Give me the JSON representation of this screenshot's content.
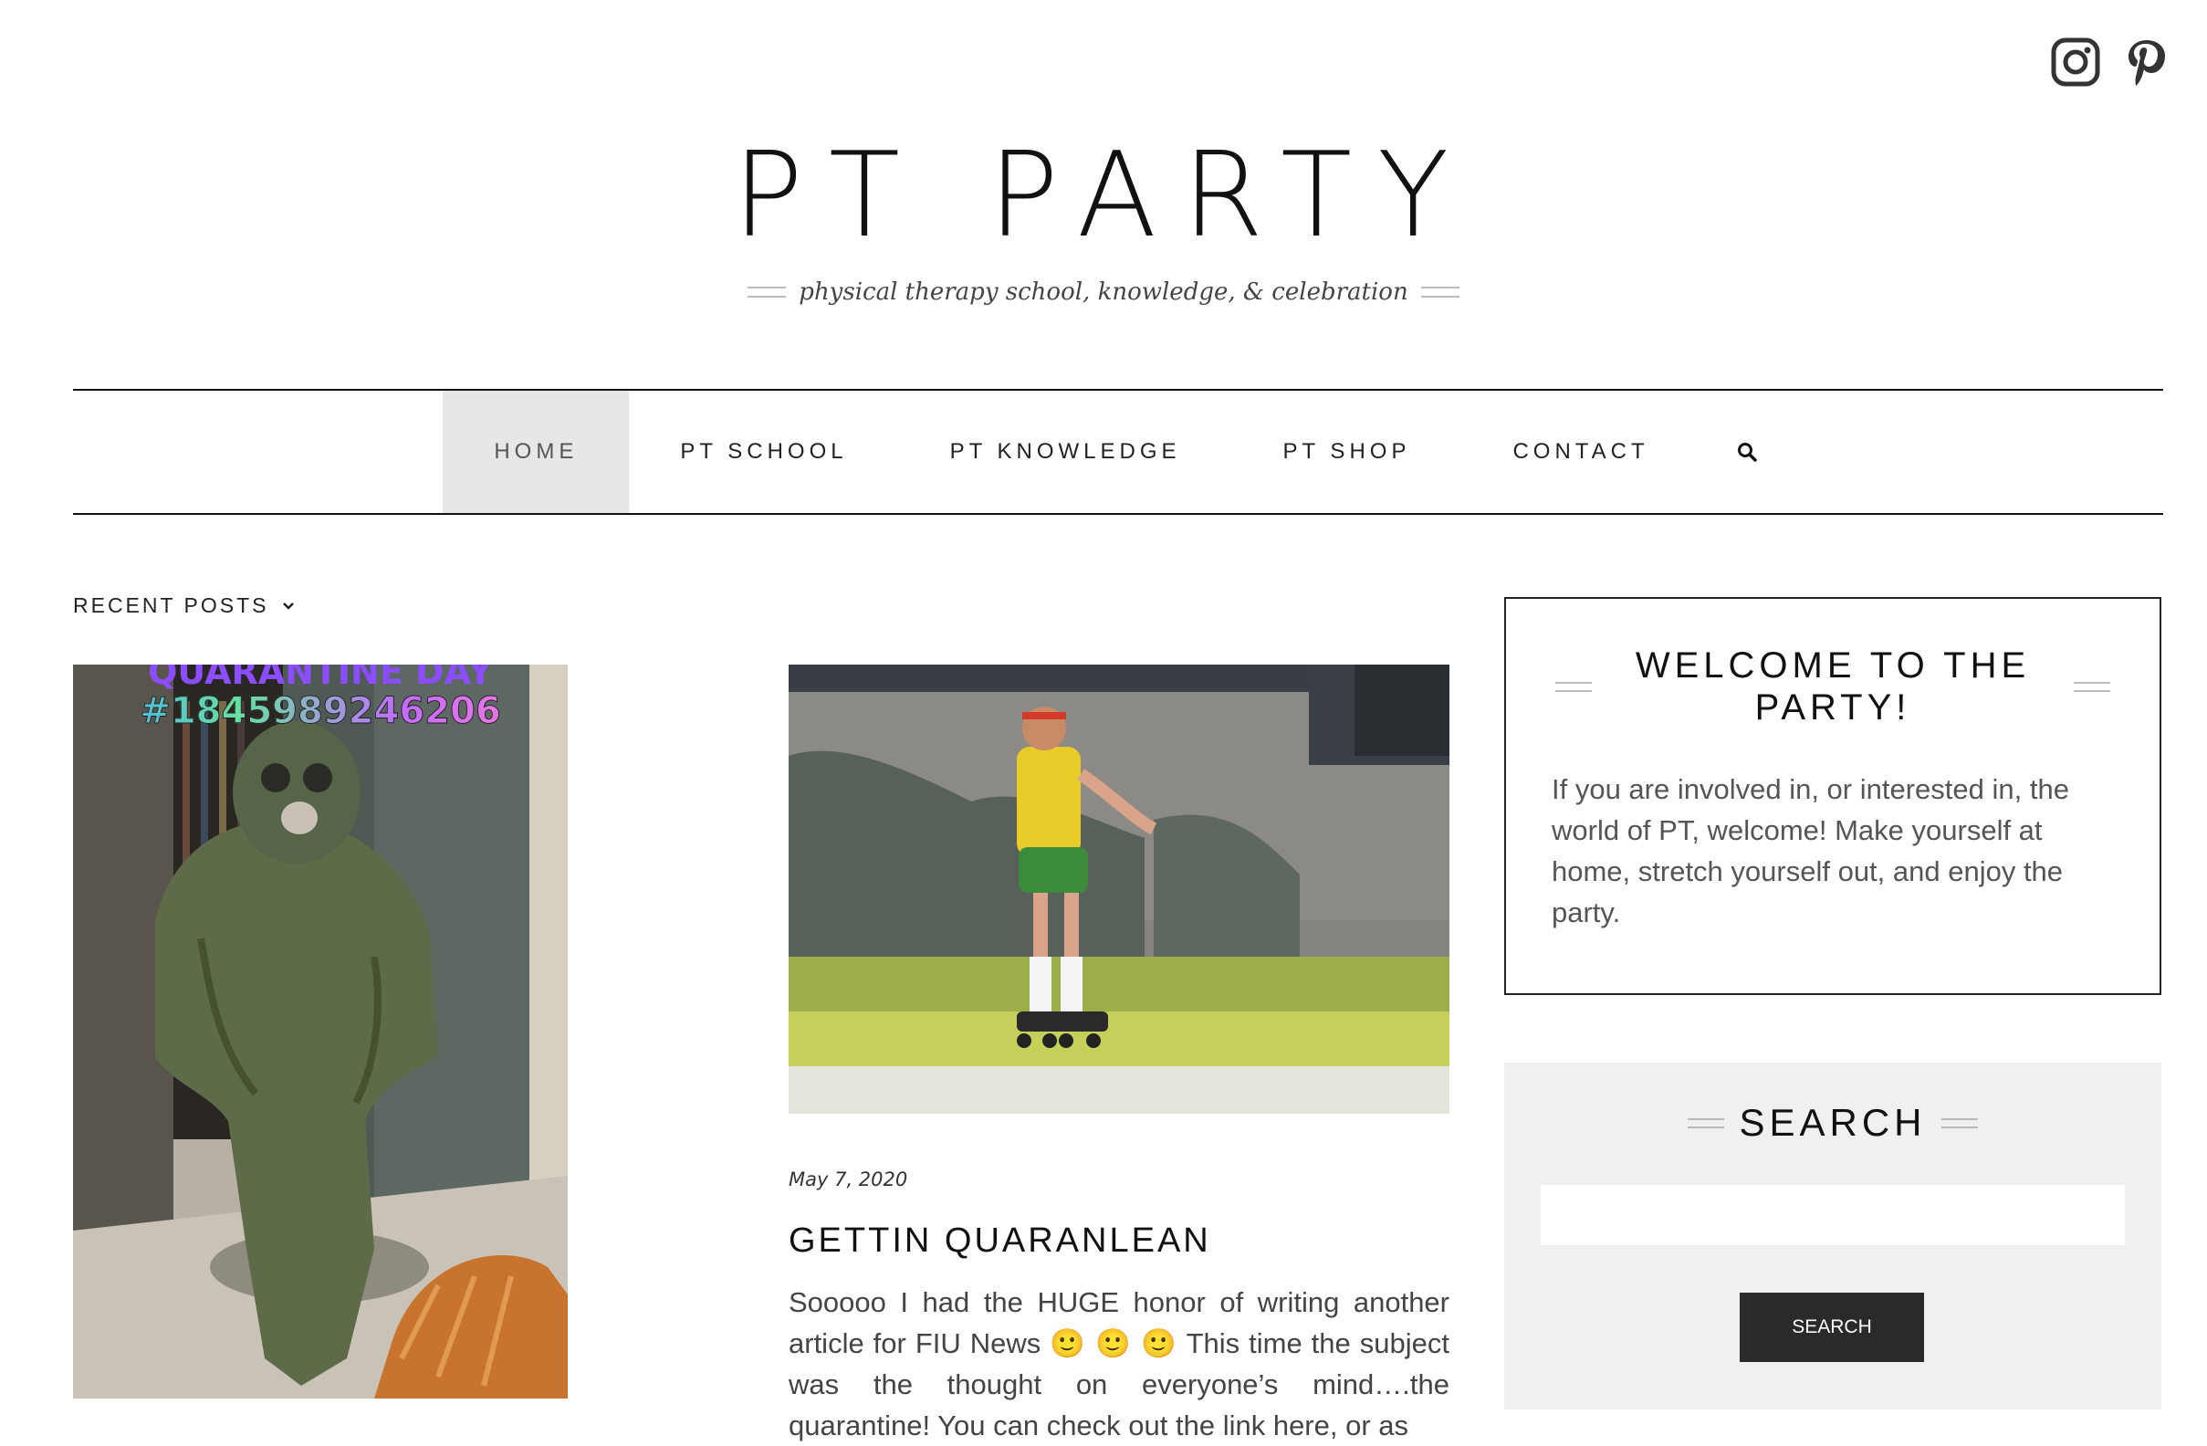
{
  "social": {
    "instagram_icon": "instagram-icon",
    "pinterest_icon": "pinterest-icon"
  },
  "header": {
    "title": "PT PARTY",
    "tagline": "physical therapy school, knowledge, & celebration"
  },
  "nav": {
    "items": [
      {
        "label": "HOME",
        "active": true
      },
      {
        "label": "PT SCHOOL"
      },
      {
        "label": "PT KNOWLEDGE"
      },
      {
        "label": "PT SHOP"
      },
      {
        "label": "CONTACT"
      }
    ],
    "search_icon": "search-icon"
  },
  "recent_posts": {
    "label": "RECENT POSTS",
    "icon": "chevron-down-icon"
  },
  "left_image": {
    "caption_line1": "QUARANTINE DAY",
    "caption_line2": "#1845989246206"
  },
  "post": {
    "date": "May 7, 2020",
    "title": "GETTIN QUARANLEAN",
    "excerpt": "Sooooo I had the HUGE honor of writing another article for FIU News 🙂 🙂 🙂 This time the subject was the thought on everyone’s mind….the quarantine! You can check out the link here, or as"
  },
  "sidebar": {
    "welcome_title": "WELCOME TO THE PARTY!",
    "welcome_text": "If you are involved in, or interested in, the world of PT, welcome!  Make yourself at home, stretch yourself out, and enjoy the party.",
    "search_title": "SEARCH",
    "search_input_value": "",
    "search_button": "SEARCH"
  },
  "colors": {
    "nav_active_bg": "#e7e7e7",
    "search_widget_bg": "#f0f0f0",
    "button_bg": "#2a2a2a"
  }
}
